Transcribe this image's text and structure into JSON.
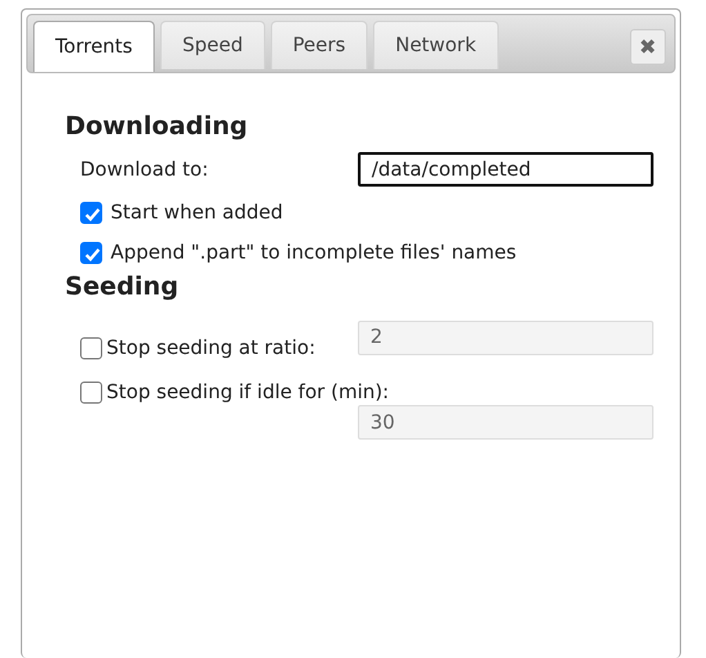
{
  "tabs": [
    {
      "label": "Torrents",
      "selected": true
    },
    {
      "label": "Speed",
      "selected": false
    },
    {
      "label": "Peers",
      "selected": false
    },
    {
      "label": "Network",
      "selected": false
    }
  ],
  "close_button": {
    "label": "✖"
  },
  "sections": [
    {
      "title": "Downloading",
      "rows": [
        {
          "kind": "field",
          "label": "Download to:",
          "value": "/data/completed",
          "focused": true,
          "disabled": false
        },
        {
          "kind": "checkbox",
          "label": "Start when added",
          "checked": true
        },
        {
          "kind": "checkbox",
          "label": "Append \".part\" to incomplete files' names",
          "checked": true
        }
      ]
    },
    {
      "title": "Seeding",
      "rows": [
        {
          "kind": "checkbox-field",
          "label": "Stop seeding at ratio:",
          "checked": false,
          "value": "2",
          "disabled": true
        },
        {
          "kind": "checkbox-field-below",
          "label": "Stop seeding if idle for (min):",
          "checked": false,
          "value": "30",
          "disabled": true
        }
      ]
    }
  ]
}
